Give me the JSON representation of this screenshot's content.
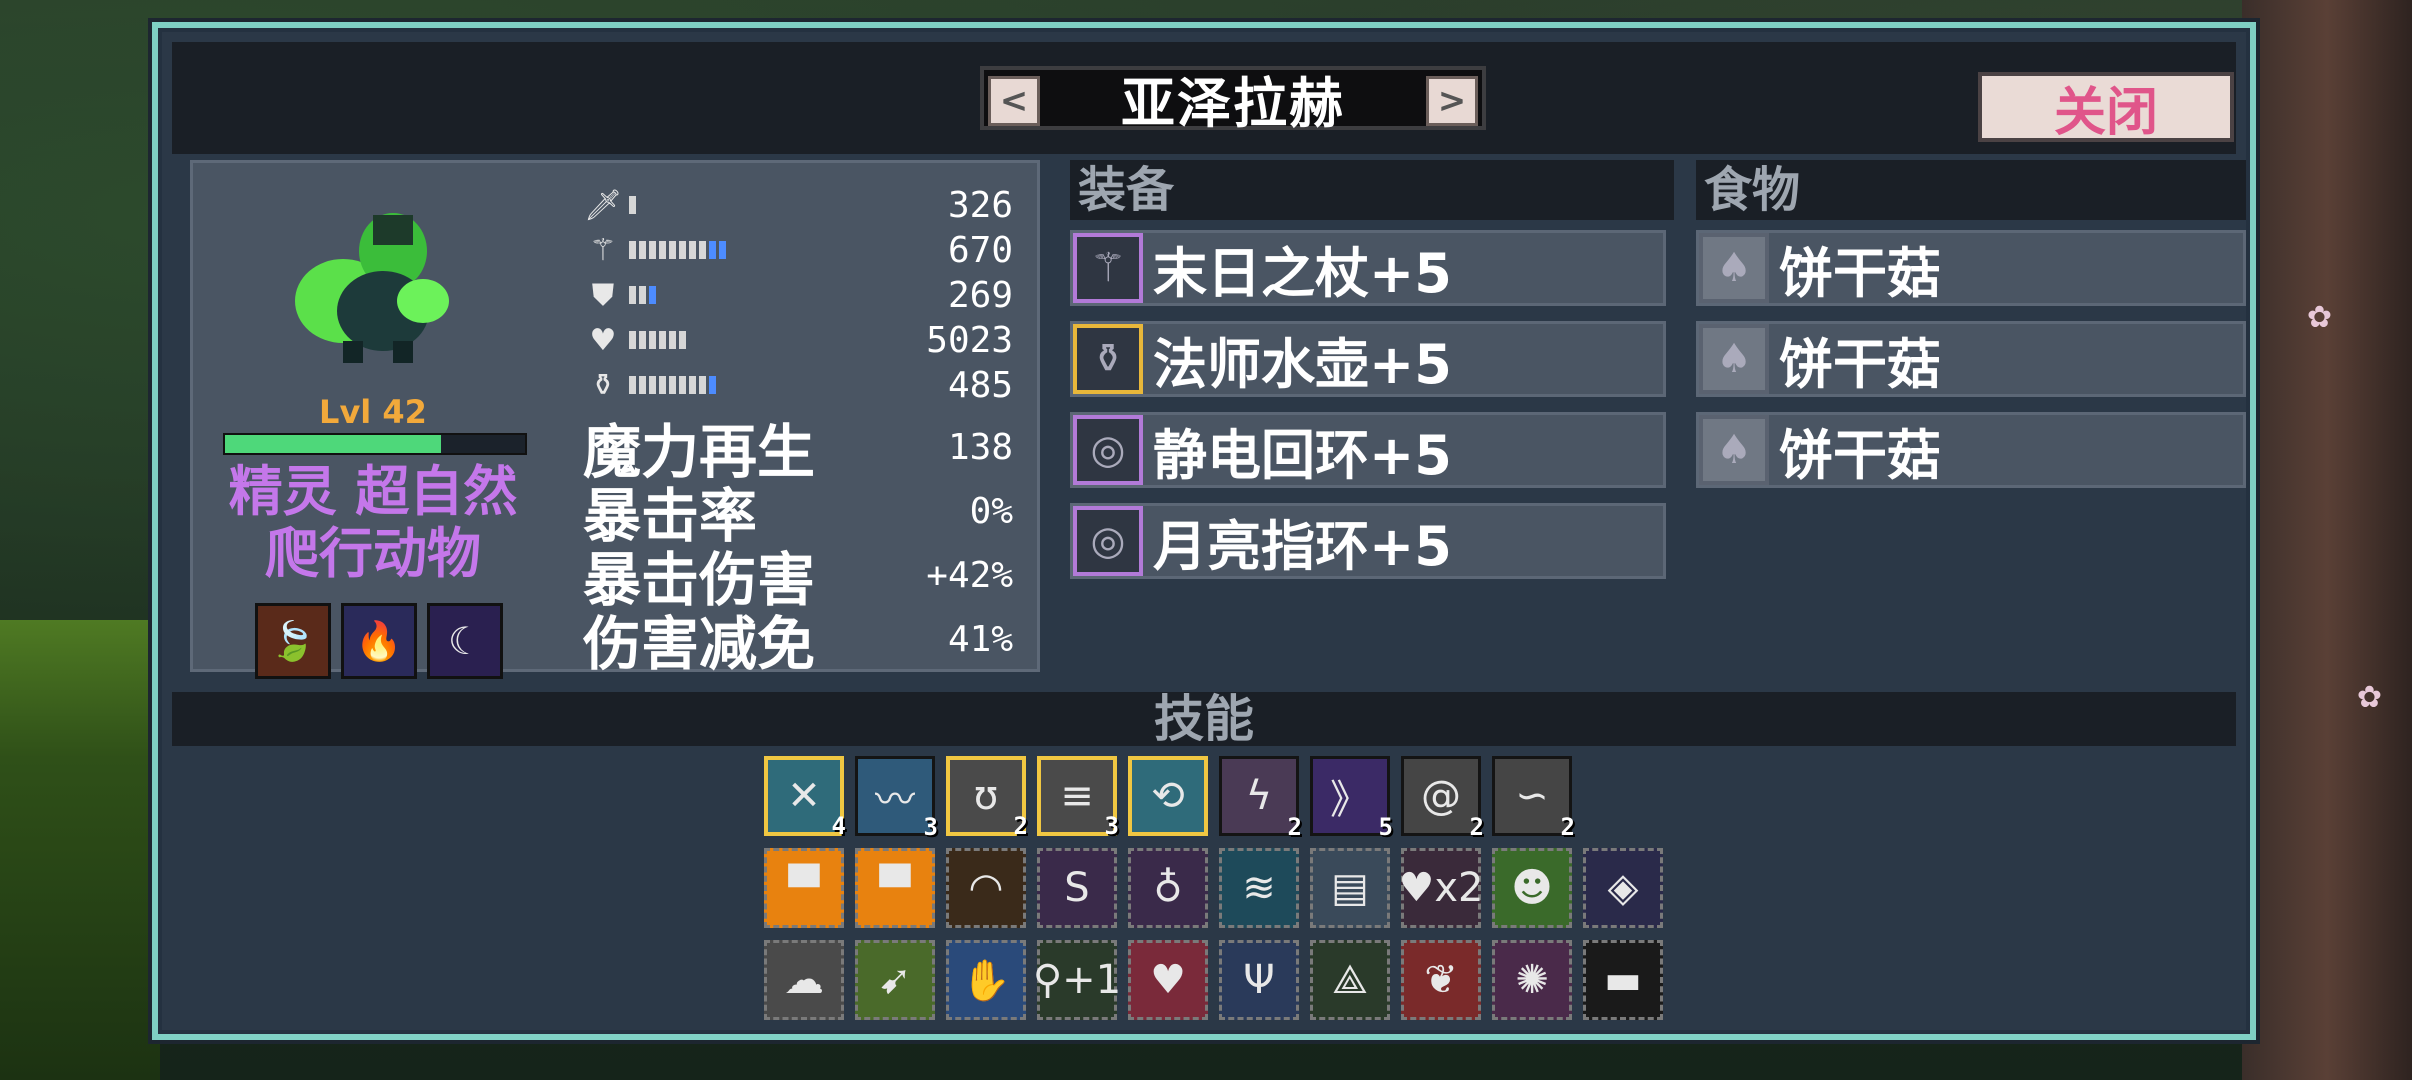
{
  "header": {
    "title": "亚泽拉赫",
    "prev_arrow": "<",
    "next_arrow": ">",
    "close_label": "关闭"
  },
  "character": {
    "level": "Lvl 42",
    "xp_progress": 0.72,
    "traits_line1": "精灵 超自然",
    "traits_line2": "爬行动物",
    "stats": [
      {
        "icon": "sword-icon",
        "glyph": "🗡",
        "bars_white": 1,
        "bars_blue": 0,
        "value": "326"
      },
      {
        "icon": "staff-icon",
        "glyph": "⚚",
        "bars_white": 8,
        "bars_blue": 2,
        "value": "670"
      },
      {
        "icon": "armor-icon",
        "glyph": "⛊",
        "bars_white": 2,
        "bars_blue": 1,
        "value": "269"
      },
      {
        "icon": "heart-icon",
        "glyph": "♥",
        "bars_white": 6,
        "bars_blue": 0,
        "value": "5023"
      },
      {
        "icon": "potion-icon",
        "glyph": "⚱",
        "bars_white": 8,
        "bars_blue": 1,
        "value": "485"
      }
    ],
    "extended": [
      {
        "label": "魔力再生",
        "value": "138"
      },
      {
        "label": "暴击率",
        "value": "0%"
      },
      {
        "label": "暴击伤害",
        "value": "+42%"
      },
      {
        "label": "伤害减免",
        "value": "41%"
      }
    ]
  },
  "equipment": {
    "header": "装备",
    "items": [
      {
        "name": "末日之杖+5",
        "icon": "staff-icon",
        "border": "#b27ad8"
      },
      {
        "name": "法师水壶+5",
        "icon": "flask-icon",
        "border": "#e8b73a"
      },
      {
        "name": "静电回环+5",
        "icon": "ring-icon",
        "border": "#b27ad8"
      },
      {
        "name": "月亮指环+5",
        "icon": "ring-icon",
        "border": "#b27ad8"
      }
    ]
  },
  "food": {
    "header": "食物",
    "items": [
      {
        "name": "饼干菇",
        "icon": "mushroom-icon"
      },
      {
        "name": "饼干菇",
        "icon": "mushroom-icon"
      },
      {
        "name": "饼干菇",
        "icon": "mushroom-icon"
      }
    ]
  },
  "skills": {
    "header": "技能",
    "active": [
      {
        "icon": "crossed-blades-icon",
        "count": "4",
        "selected": true,
        "color": "#2f6b7a"
      },
      {
        "icon": "lightning-icon",
        "count": "3",
        "selected": false,
        "color": "#2f5a7a"
      },
      {
        "icon": "tornado-icon",
        "count": "2",
        "selected": true,
        "color": "#4a4a4a"
      },
      {
        "icon": "wind-icon",
        "count": "3",
        "selected": true,
        "color": "#4a4a4a"
      },
      {
        "icon": "spin-blade-icon",
        "count": "",
        "selected": true,
        "color": "#2f6b7a"
      },
      {
        "icon": "magic-bolt-icon",
        "count": "2",
        "selected": false,
        "color": "#4a3a55"
      },
      {
        "icon": "purple-slash-icon",
        "count": "5",
        "selected": false,
        "color": "#3b2a66"
      },
      {
        "icon": "swirl-icon",
        "count": "2",
        "selected": false,
        "color": "#454545"
      },
      {
        "icon": "gust-icon",
        "count": "2",
        "selected": false,
        "color": "#454545"
      }
    ],
    "passive_row1": [
      {
        "icon": "cool-face-icon",
        "count": "",
        "color": "#e8820f"
      },
      {
        "icon": "cool-face-icon",
        "count": "",
        "color": "#e8820f"
      },
      {
        "icon": "eyes-icon",
        "count": "",
        "color": "#3a2a1a"
      },
      {
        "icon": "cycle-icon",
        "count": "",
        "color": "#3a2a4a"
      },
      {
        "icon": "potion-icon",
        "count": "",
        "color": "#3a2a4a"
      },
      {
        "icon": "aura-icon",
        "count": "",
        "color": "#1e4a5a"
      },
      {
        "icon": "scroll-icon",
        "count": "",
        "color": "#3a4a5a"
      },
      {
        "icon": "heart-icon",
        "count": "x2",
        "color": "#3a2a3a"
      },
      {
        "icon": "monster-icon",
        "count": "",
        "color": "#3a6a2a"
      },
      {
        "icon": "dark-wing-icon",
        "count": "",
        "color": "#2a2a4a"
      }
    ],
    "passive_row2": [
      {
        "icon": "cloud-icon",
        "count": "",
        "color": "#4a4a4a"
      },
      {
        "icon": "arrow-boost-icon",
        "count": "",
        "color": "#4a6a2a"
      },
      {
        "icon": "blue-hand-icon",
        "count": "",
        "color": "#2a4a7a"
      },
      {
        "icon": "key-icon",
        "count": "+1",
        "color": "#2a3a2a"
      },
      {
        "icon": "heart-plus-icon",
        "count": "",
        "color": "#7a2a3a"
      },
      {
        "icon": "blue-claw-icon",
        "count": "",
        "color": "#2a3a5a"
      },
      {
        "icon": "compass-icon",
        "count": "",
        "color": "#2a3a2a"
      },
      {
        "icon": "hearts-icon",
        "count": "",
        "color": "#7a2a2a"
      },
      {
        "icon": "pink-orb-icon",
        "count": "",
        "color": "#4a2a4a"
      },
      {
        "icon": "mask-icon",
        "count": "",
        "color": "#1a1a1a"
      }
    ]
  },
  "buffs": [
    {
      "icon": "leaf-up-icon",
      "glyph": "🍃",
      "color": "#5a2a1a"
    },
    {
      "icon": "fire-shield-icon",
      "glyph": "🔥",
      "color": "#2a2a5a"
    },
    {
      "icon": "moon-icon",
      "glyph": "☾",
      "color": "#2a2050"
    }
  ]
}
